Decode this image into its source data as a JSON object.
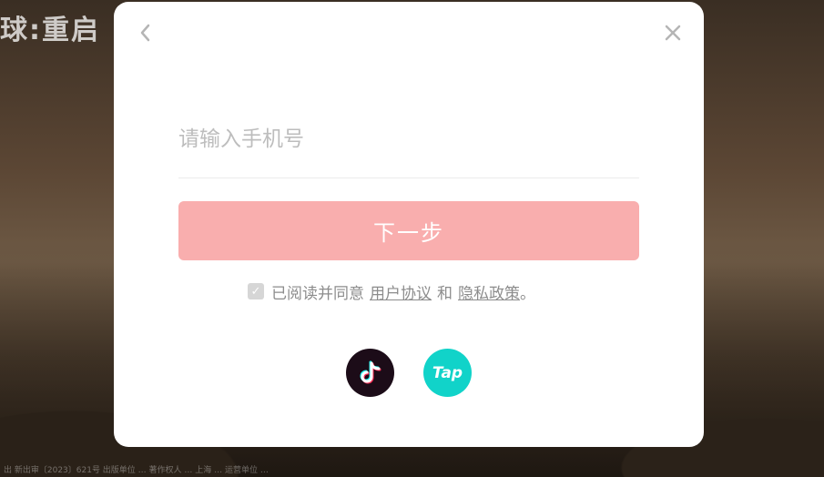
{
  "background": {
    "logo_text": "球:重启",
    "footer_text": "出 新出审〔2023〕621号 出版单位 … 著作权人 … 上海 … 运营单位 …"
  },
  "modal": {
    "back_icon": "chevron-left-icon",
    "close_icon": "close-icon",
    "phone_placeholder": "请输入手机号",
    "phone_value": "",
    "next_label": "下一步",
    "agree_prefix": "已阅读并同意",
    "user_agreement": "用户协议",
    "and_text": "和",
    "privacy_policy": "隐私政策",
    "period": "。",
    "agreement_checked": true,
    "social": [
      {
        "name": "douyin",
        "icon": "douyin-icon",
        "color": "#1c0c18"
      },
      {
        "name": "taptap",
        "label": "Tap",
        "icon": "taptap-icon",
        "color": "#11d3c9"
      }
    ]
  },
  "colors": {
    "accent_button": "#f9aeae",
    "link_text": "#8c8c8c"
  }
}
